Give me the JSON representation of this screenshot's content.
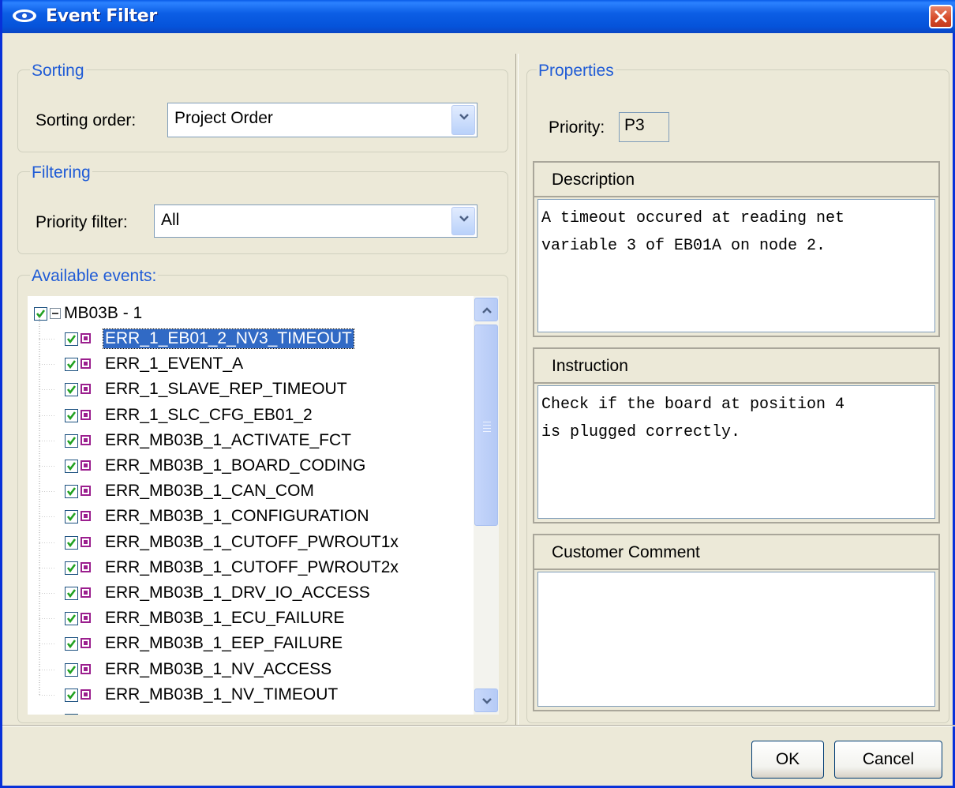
{
  "window": {
    "title": "Event Filter"
  },
  "sorting": {
    "legend": "Sorting",
    "order_label": "Sorting order:",
    "order_value": "Project Order"
  },
  "filtering": {
    "legend": "Filtering",
    "priority_label": "Priority filter:",
    "priority_value": "All"
  },
  "events": {
    "legend": "Available events:",
    "root": {
      "label": "MB03B - 1",
      "checked": true,
      "expanded": true
    },
    "items": [
      {
        "label": "ERR_1_EB01_2_NV3_TIMEOUT",
        "checked": true,
        "selected": true
      },
      {
        "label": "ERR_1_EVENT_A",
        "checked": true
      },
      {
        "label": "ERR_1_SLAVE_REP_TIMEOUT",
        "checked": true
      },
      {
        "label": "ERR_1_SLC_CFG_EB01_2",
        "checked": true
      },
      {
        "label": "ERR_MB03B_1_ACTIVATE_FCT",
        "checked": true
      },
      {
        "label": "ERR_MB03B_1_BOARD_CODING",
        "checked": true
      },
      {
        "label": "ERR_MB03B_1_CAN_COM",
        "checked": true
      },
      {
        "label": "ERR_MB03B_1_CONFIGURATION",
        "checked": true
      },
      {
        "label": "ERR_MB03B_1_CUTOFF_PWROUT1x",
        "checked": true
      },
      {
        "label": "ERR_MB03B_1_CUTOFF_PWROUT2x",
        "checked": true
      },
      {
        "label": "ERR_MB03B_1_DRV_IO_ACCESS",
        "checked": true
      },
      {
        "label": "ERR_MB03B_1_ECU_FAILURE",
        "checked": true
      },
      {
        "label": "ERR_MB03B_1_EEP_FAILURE",
        "checked": true
      },
      {
        "label": "ERR_MB03B_1_NV_ACCESS",
        "checked": true
      },
      {
        "label": "ERR_MB03B_1_NV_TIMEOUT",
        "checked": true
      }
    ]
  },
  "properties": {
    "legend": "Properties",
    "priority_label": "Priority:",
    "priority_value": "P3",
    "description_header": "Description",
    "description_text": "A timeout occured at reading net\nvariable 3 of EB01A on node 2.",
    "instruction_header": "Instruction",
    "instruction_text": "Check if the board at position 4\nis plugged correctly.",
    "comment_header": "Customer Comment",
    "comment_text": ""
  },
  "buttons": {
    "ok": "OK",
    "cancel": "Cancel"
  },
  "colors": {
    "title_bar": "#0c5ee5",
    "legend_text": "#1f5bd6",
    "selection": "#316ac5",
    "check": "#21a121",
    "event_icon": "#9b1f8e"
  }
}
